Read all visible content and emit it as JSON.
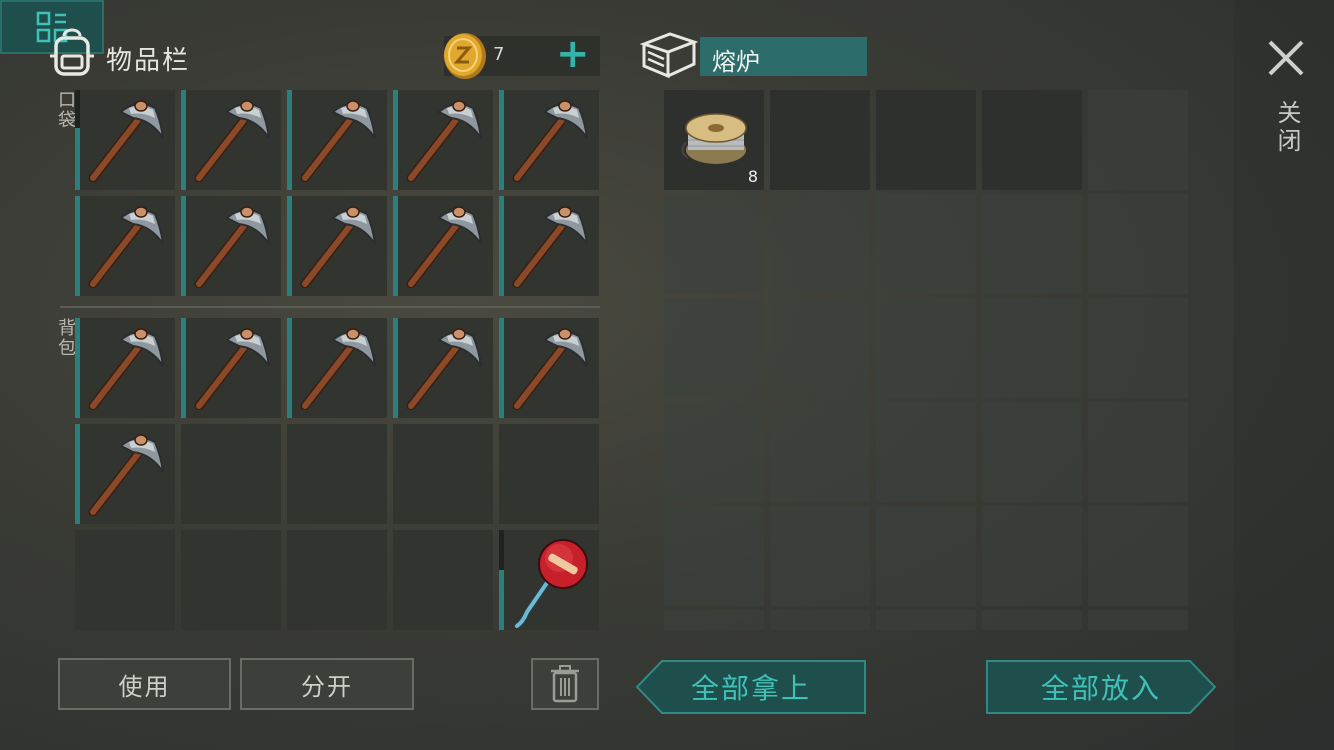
{
  "inventory": {
    "title": "物品栏",
    "coin_count": "7",
    "pocket_label": "口袋",
    "backpack_label": "背包",
    "pocket_items": [
      "pickaxe",
      "pickaxe",
      "pickaxe",
      "pickaxe",
      "pickaxe",
      "pickaxe",
      "pickaxe",
      "pickaxe",
      "pickaxe",
      "pickaxe"
    ],
    "backpack_items": [
      "pickaxe",
      "pickaxe",
      "pickaxe",
      "pickaxe",
      "pickaxe",
      "pickaxe",
      "",
      "",
      "",
      "",
      "",
      "",
      "",
      "",
      "stop-sign"
    ]
  },
  "container": {
    "title": "熔炉",
    "slots": [
      {
        "item": "wire-spool",
        "count": "8"
      }
    ]
  },
  "close_label": "关闭",
  "buttons": {
    "use": "使用",
    "split": "分开",
    "take_all": "全部拿上",
    "put_all": "全部放入"
  },
  "colors": {
    "accent": "#34b3a8",
    "furnace_title_bg": "#2c6c6a",
    "durability_bar": "#2c7f7c"
  },
  "icons": [
    "backpack-icon",
    "coin-icon",
    "plus-icon",
    "chest-icon",
    "close-icon",
    "trash-icon",
    "sort-icon",
    "pickaxe-icon",
    "stop-sign-icon",
    "wire-spool-icon"
  ]
}
